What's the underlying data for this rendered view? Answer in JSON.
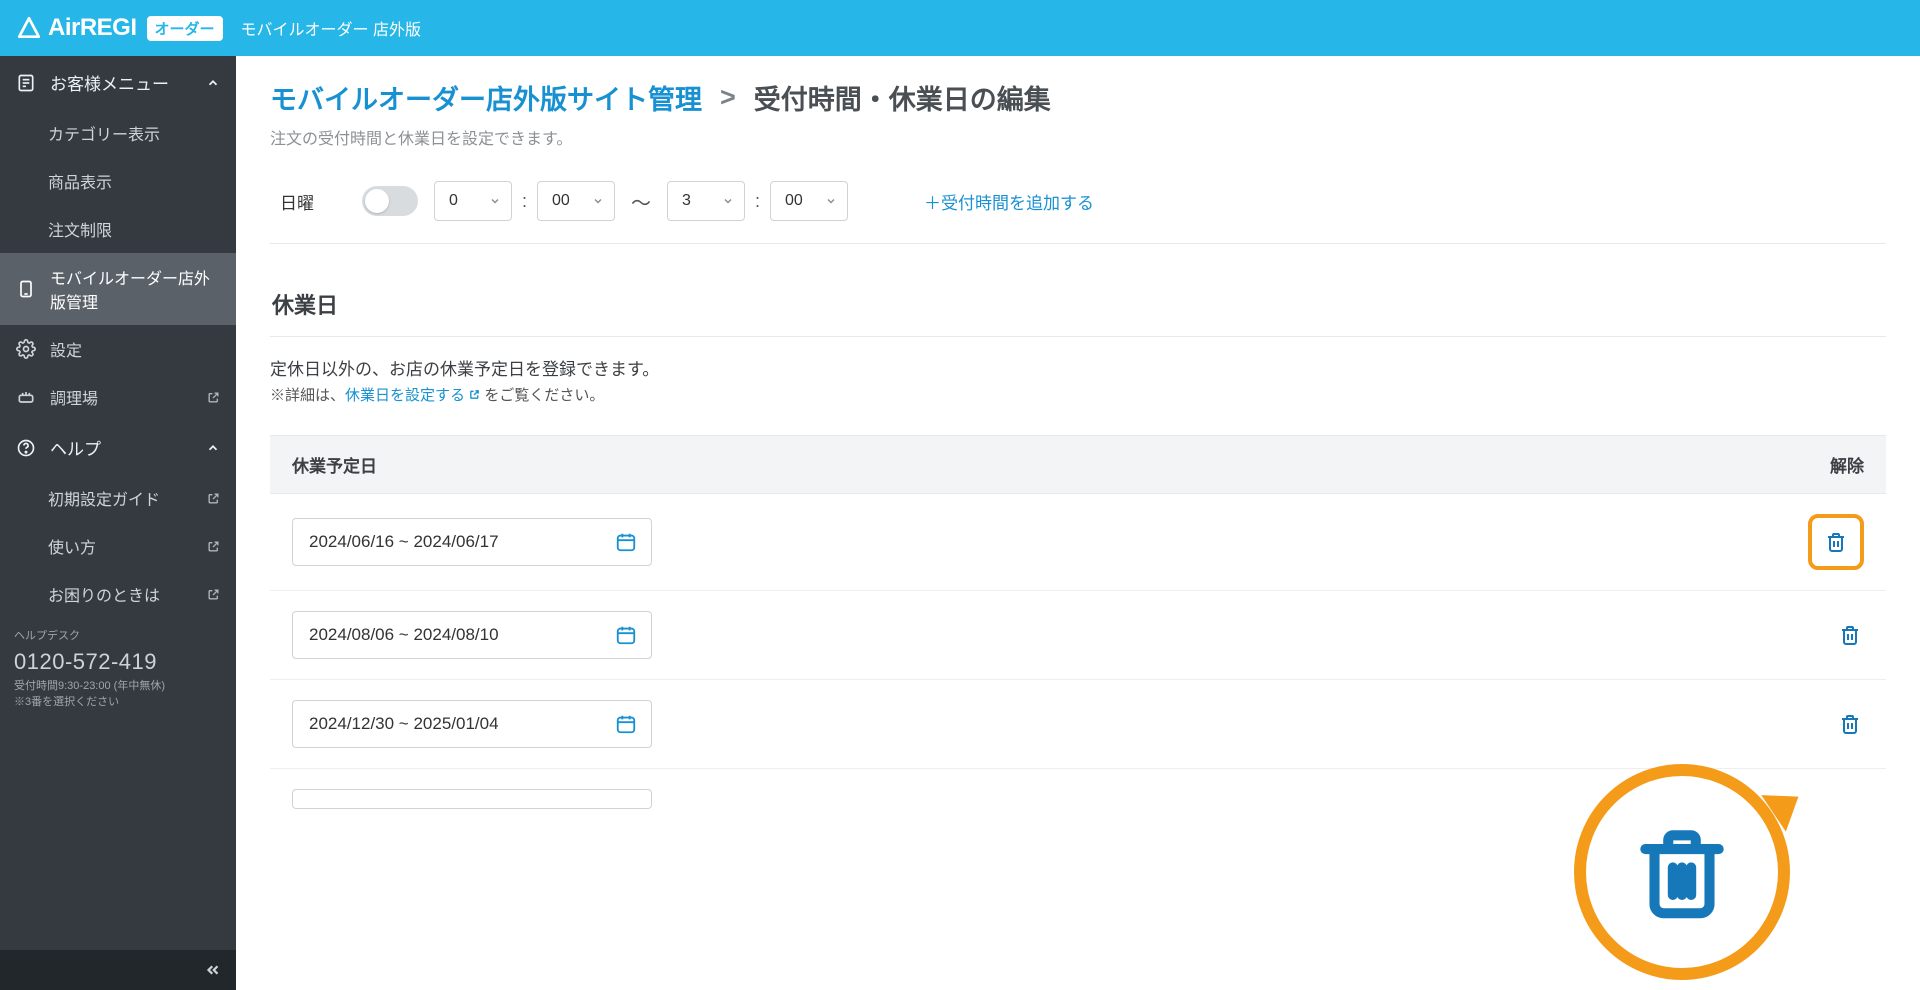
{
  "header": {
    "brand_prefix": "Air",
    "brand_suffix": "REGI",
    "brand_badge": "オーダー",
    "subtitle": "モバイルオーダー 店外版"
  },
  "sidebar": {
    "customer_menu": "お客様メニュー",
    "items": {
      "category": "カテゴリー表示",
      "product": "商品表示",
      "order_limit": "注文制限",
      "mobile_order_mgmt": "モバイルオーダー店外版管理",
      "settings": "設定",
      "kitchen": "調理場",
      "help": "ヘルプ",
      "guide": "初期設定ガイド",
      "howto": "使い方",
      "trouble": "お困りのときは"
    },
    "helpdesk": {
      "label": "ヘルプデスク",
      "phone": "0120-572-419",
      "hours": "受付時間9:30-23:00 (年中無休)",
      "note": "※3番を選択ください"
    }
  },
  "breadcrumb": {
    "link": "モバイルオーダー店外版サイト管理",
    "sep": ">",
    "current": "受付時間・休業日の編集"
  },
  "page_desc": "注文の受付時間と休業日を設定できます。",
  "time_row": {
    "day": "日曜",
    "h1": "0",
    "m1": "00",
    "tilde": "〜",
    "h2": "3",
    "m2": "00",
    "add_link": "＋受付時間を追加する"
  },
  "holiday": {
    "title": "休業日",
    "desc": "定休日以外の、お店の休業予定日を登録できます。",
    "note_prefix": "※詳細は、",
    "note_link": "休業日を設定する",
    "note_suffix": " をご覧ください。",
    "col_date": "休業予定日",
    "col_remove": "解除",
    "rows": [
      "2024/06/16 ~ 2024/06/17",
      "2024/08/06 ~ 2024/08/10",
      "2024/12/30 ~ 2025/01/04"
    ]
  }
}
